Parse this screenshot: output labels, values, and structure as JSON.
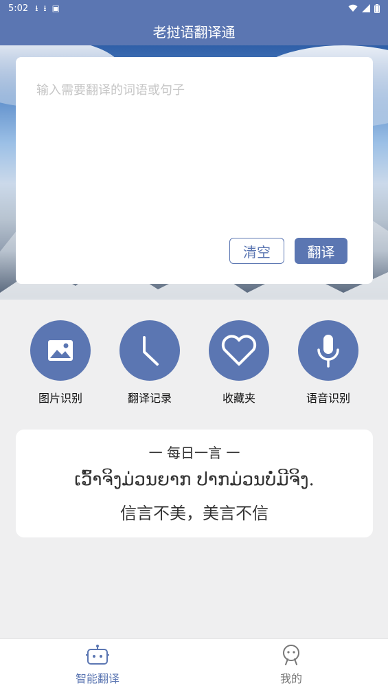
{
  "status_bar": {
    "time": "5:02",
    "notification_icons": [
      "download-icon",
      "download-icon",
      "app-icon"
    ],
    "system_icons": [
      "wifi-icon",
      "signal-icon",
      "battery-icon"
    ]
  },
  "header": {
    "title": "老挝语翻译通"
  },
  "input": {
    "placeholder": "输入需要翻译的词语或句子",
    "value": "",
    "clear_label": "清空",
    "translate_label": "翻译"
  },
  "features": [
    {
      "label": "图片识别",
      "icon": "image-icon"
    },
    {
      "label": "翻译记录",
      "icon": "clock-icon"
    },
    {
      "label": "收藏夹",
      "icon": "heart-icon"
    },
    {
      "label": "语音识别",
      "icon": "microphone-icon"
    }
  ],
  "quote": {
    "title": "一  每日一言  一",
    "lao": "ເວົ້າຈິງມ່ວນຍາກ ປາກມ່ວນບໍ່ມີຈິງ.",
    "chinese": "信言不美，美言不信"
  },
  "bottom_nav": {
    "items": [
      {
        "label": "智能翻译",
        "icon": "robot-icon",
        "active": true
      },
      {
        "label": "我的",
        "icon": "user-icon",
        "active": false
      }
    ]
  },
  "colors": {
    "primary": "#5b76b2",
    "background": "#efeff0"
  }
}
